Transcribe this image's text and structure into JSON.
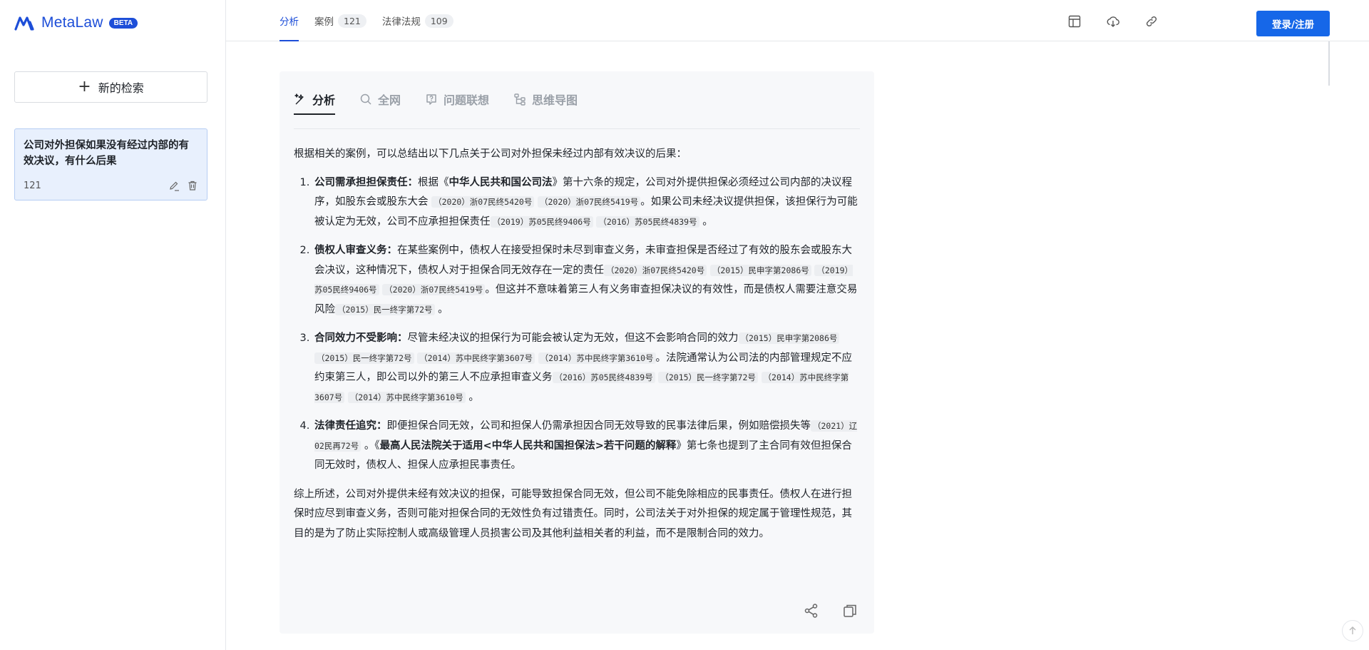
{
  "brand": {
    "name": "MetaLaw",
    "badge": "BETA"
  },
  "sidebar": {
    "new_search_label": "新的检索",
    "history": [
      {
        "title": "公司对外担保如果没有经过内部的有效决议，有什么后果",
        "count": "121"
      }
    ]
  },
  "topbar": {
    "tabs": [
      {
        "label": "分析",
        "count": ""
      },
      {
        "label": "案例",
        "count": "121"
      },
      {
        "label": "法律法规",
        "count": "109"
      }
    ],
    "login_label": "登录/注册"
  },
  "card": {
    "tabs": [
      "分析",
      "全网",
      "问题联想",
      "思维导图"
    ],
    "intro": "根据相关的案例，可以总结出以下几点关于公司对外担保未经过内部有效决议的后果：",
    "items": [
      {
        "title": "公司需承担担保责任：",
        "t1": "根据《",
        "law": "中华人民共和国公司法",
        "t2": "》第十六条的规定，公司对外提供担保必须经过公司内部的决议程序，如股东会或股东大会",
        "r1": "（2020）浙07民终5420号",
        "r2": "（2020）浙07民终5419号",
        "t3": "。如果公司未经决议提供担保，该担保行为可能被认定为无效，公司不应承担担保责任",
        "r3": "（2019）苏05民终9406号",
        "r4": "（2016）苏05民终4839号",
        "t4": "。"
      },
      {
        "title": "债权人审查义务：",
        "t1": "在某些案例中，债权人在接受担保时未尽到审查义务，未审查担保是否经过了有效的股东会或股东大会决议，这种情况下，债权人对于担保合同无效存在一定的责任",
        "r1": "（2020）浙07民终5420号",
        "r2": "（2015）民申字第2086号",
        "r3": "（2019）苏05民终9406号",
        "r4": "（2020）浙07民终5419号",
        "t2": "。但这并不意味着第三人有义务审查担保决议的有效性，而是债权人需要注意交易风险",
        "r5": "（2015）民一终字第72号",
        "t3": "。"
      },
      {
        "title": "合同效力不受影响：",
        "t1": "尽管未经决议的担保行为可能会被认定为无效，但这不会影响合同的效力",
        "r1": "（2015）民申字第2086号",
        "r2": "（2015）民一终字第72号",
        "r3": "（2014）苏中民终字第3607号",
        "r4": "（2014）苏中民终字第3610号",
        "t2": "。法院通常认为公司法的内部管理规定不应约束第三人，即公司以外的第三人不应承担审查义务",
        "r5": "（2016）苏05民终4839号",
        "r6": "（2015）民一终字第72号",
        "r7": "（2014）苏中民终字第3607号",
        "r8": "（2014）苏中民终字第3610号",
        "t3": "。"
      },
      {
        "title": "法律责任追究：",
        "t1": "即便担保合同无效，公司和担保人仍需承担因合同无效导致的民事法律后果，例如赔偿损失等",
        "r1": "（2021）辽02民再72号",
        "t2": "。《",
        "law": "最高人民法院关于适用<中华人民共和国担保法>若干问题的解释",
        "t3": "》第七条也提到了主合同有效但担保合同无效时，债权人、担保人应承担民事责任。"
      }
    ],
    "summary": "综上所述，公司对外提供未经有效决议的担保，可能导致担保合同无效，但公司不能免除相应的民事责任。债权人在进行担保时应尽到审查义务，否则可能对担保合同的无效性负有过错责任。同时，公司法关于对外担保的规定属于管理性规范，其目的是为了防止实际控制人或高级管理人员损害公司及其他利益相关者的利益，而不是限制合同的效力。"
  },
  "colors": {
    "accent": "#1d4ed8",
    "button": "#1667e8"
  }
}
